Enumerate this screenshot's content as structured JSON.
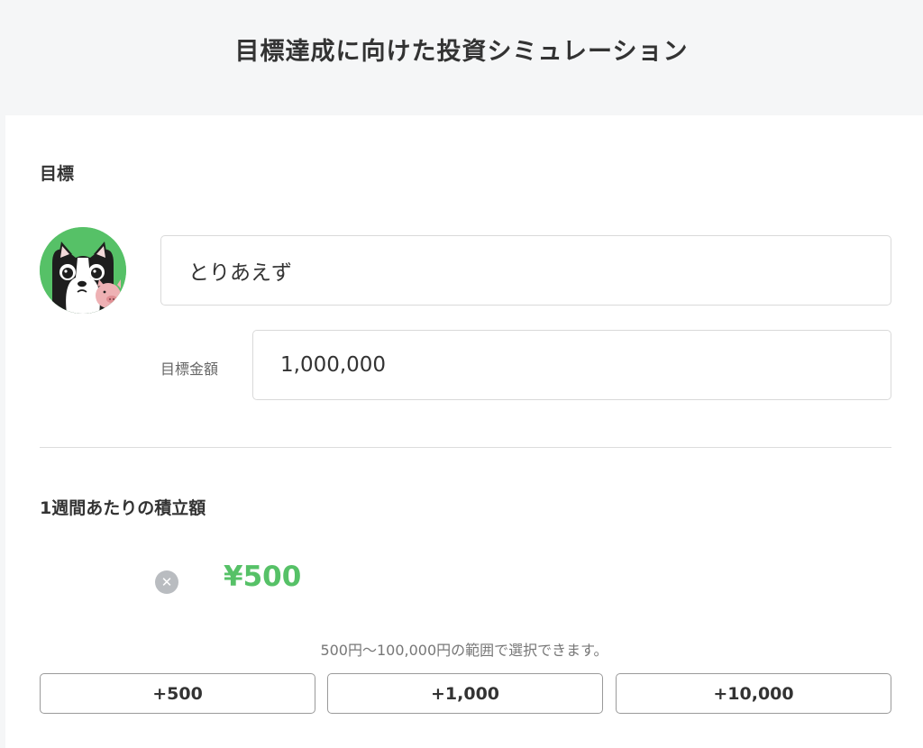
{
  "header": {
    "title": "目標達成に向けた投資シミュレーション"
  },
  "goal": {
    "section_title": "目標",
    "name_value": "とりあえず",
    "amount_label": "目標金額",
    "amount_value": "1,000,000"
  },
  "weekly": {
    "section_title": "1週間あたりの積立額",
    "amount": "¥500",
    "hint": "500円〜100,000円の範囲で選択できます。",
    "buttons": [
      {
        "label": "+500"
      },
      {
        "label": "+1,000"
      },
      {
        "label": "+10,000"
      }
    ]
  },
  "icons": {
    "avatar": "dog-avatar-icon",
    "clear": "clear-icon"
  },
  "colors": {
    "accent": "#56c167",
    "background": "#f5f6f7",
    "clear_button": "#b9bcc0"
  }
}
